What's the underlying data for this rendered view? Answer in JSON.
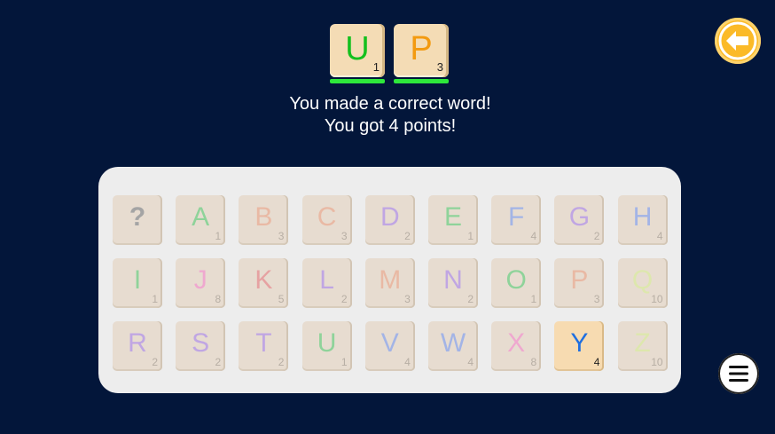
{
  "word_tiles": [
    {
      "letter": "U",
      "points": "1",
      "color": "#14c01e"
    },
    {
      "letter": "P",
      "points": "3",
      "color": "#f39a10"
    }
  ],
  "message": {
    "line1": "You made a correct word!",
    "line2": "You got 4 points!"
  },
  "keyboard": {
    "rows": [
      [
        {
          "letter": "?",
          "points": "",
          "color": "#a4a4a4"
        },
        {
          "letter": "A",
          "points": "1",
          "color": "#8fd39a"
        },
        {
          "letter": "B",
          "points": "3",
          "color": "#e9b9a4"
        },
        {
          "letter": "C",
          "points": "3",
          "color": "#e9b9a4"
        },
        {
          "letter": "D",
          "points": "2",
          "color": "#c0a6e3"
        },
        {
          "letter": "E",
          "points": "1",
          "color": "#8fd39a"
        },
        {
          "letter": "F",
          "points": "4",
          "color": "#a3b4e6"
        },
        {
          "letter": "G",
          "points": "2",
          "color": "#c0a6e3"
        },
        {
          "letter": "H",
          "points": "4",
          "color": "#a3b4e6"
        }
      ],
      [
        {
          "letter": "I",
          "points": "1",
          "color": "#8fd39a"
        },
        {
          "letter": "J",
          "points": "8",
          "color": "#efa8cf"
        },
        {
          "letter": "K",
          "points": "5",
          "color": "#e6a2a2"
        },
        {
          "letter": "L",
          "points": "2",
          "color": "#c0a6e3"
        },
        {
          "letter": "M",
          "points": "3",
          "color": "#e9b9a4"
        },
        {
          "letter": "N",
          "points": "2",
          "color": "#c0a6e3"
        },
        {
          "letter": "O",
          "points": "1",
          "color": "#8fd39a"
        },
        {
          "letter": "P",
          "points": "3",
          "color": "#e9b9a4"
        },
        {
          "letter": "Q",
          "points": "10",
          "color": "#dde7ad"
        }
      ],
      [
        {
          "letter": "R",
          "points": "2",
          "color": "#c0a6e3"
        },
        {
          "letter": "S",
          "points": "2",
          "color": "#c0a6e3"
        },
        {
          "letter": "T",
          "points": "2",
          "color": "#c0a6e3"
        },
        {
          "letter": "U",
          "points": "1",
          "color": "#8fd39a"
        },
        {
          "letter": "V",
          "points": "4",
          "color": "#a3b4e6"
        },
        {
          "letter": "W",
          "points": "4",
          "color": "#a3b4e6"
        },
        {
          "letter": "X",
          "points": "8",
          "color": "#efa8cf"
        },
        {
          "letter": "Y",
          "points": "4",
          "color": "#1f6fe0",
          "active": true
        },
        {
          "letter": "Z",
          "points": "10",
          "color": "#dde7ad"
        }
      ]
    ]
  },
  "buttons": {
    "back_icon": "arrow-left-icon",
    "menu_icon": "hamburger-menu-icon",
    "back_color": "#fbba28"
  }
}
